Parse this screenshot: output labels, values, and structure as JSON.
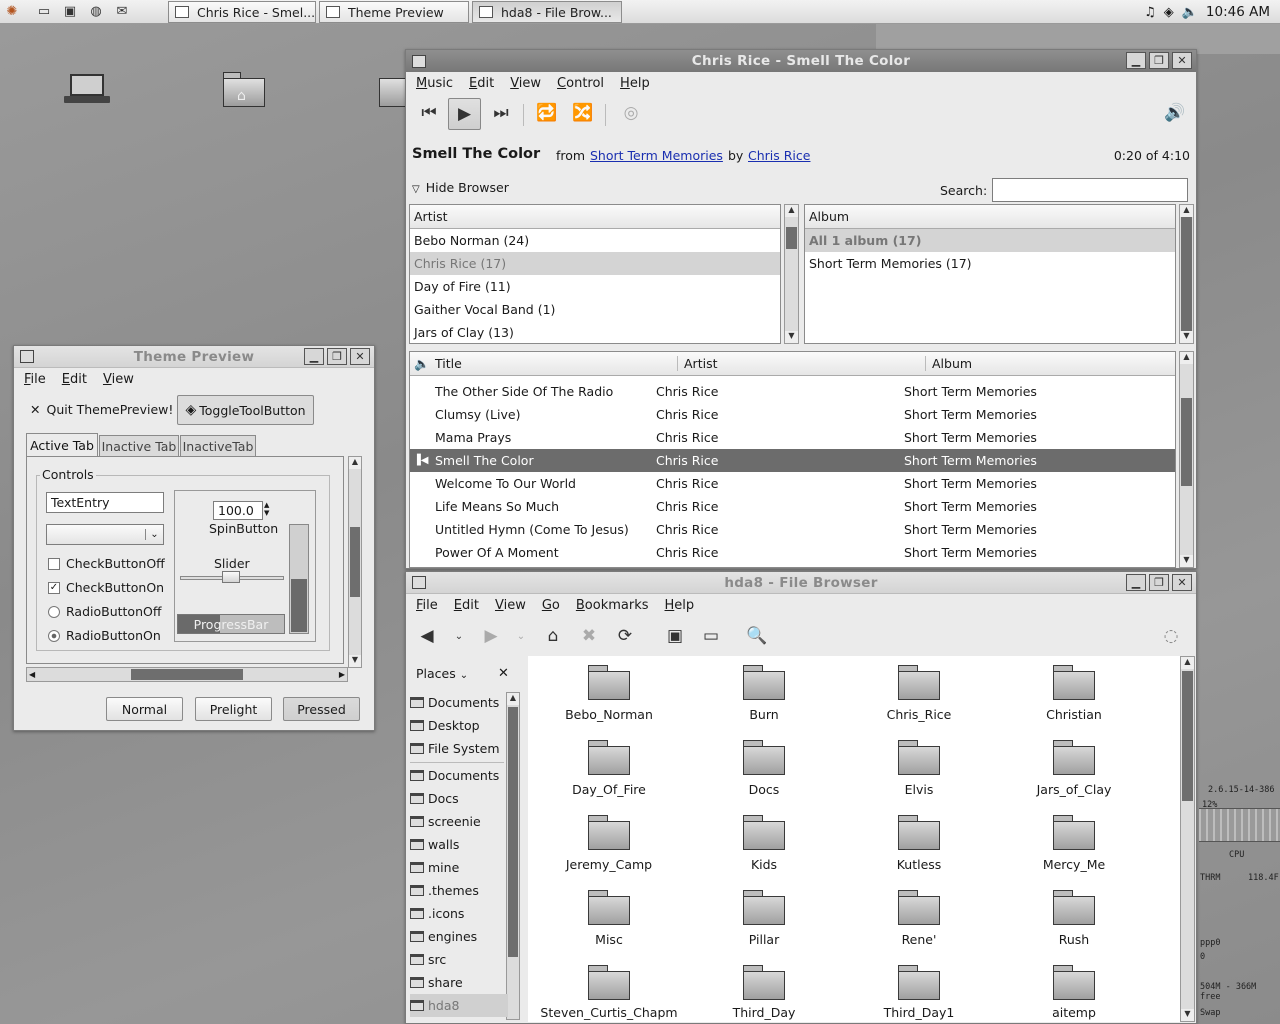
{
  "panel": {
    "tasks": [
      "Chris Rice - Smel...",
      "Theme Preview",
      "hda8 - File Brow..."
    ],
    "clock": "10:46 AM"
  },
  "music": {
    "title": "Chris Rice - Smell The Color",
    "menu": [
      "Music",
      "Edit",
      "View",
      "Control",
      "Help"
    ],
    "song": "Smell The Color",
    "from": "from",
    "album_link": "Short Term Memories",
    "by": "by",
    "artist_link": "Chris Rice",
    "time": "0:20 of 4:10",
    "hide_browser": "Hide Browser",
    "search_label": "Search:",
    "search_value": "",
    "artist_header": "Artist",
    "artists": [
      "Bebo Norman (24)",
      "Chris Rice (17)",
      "Day of Fire (11)",
      "Gaither Vocal Band (1)",
      "Jars of Clay (13)"
    ],
    "album_header": "Album",
    "albums": [
      "All 1 album (17)",
      "Short Term Memories (17)"
    ],
    "track_headers": [
      "Title",
      "Artist",
      "Album"
    ],
    "tracks": [
      {
        "title": "The Other Side Of The Radio",
        "artist": "Chris Rice",
        "album": "Short Term Memories"
      },
      {
        "title": "Clumsy (Live)",
        "artist": "Chris Rice",
        "album": "Short Term Memories"
      },
      {
        "title": "Mama Prays",
        "artist": "Chris Rice",
        "album": "Short Term Memories"
      },
      {
        "title": "Smell The Color",
        "artist": "Chris Rice",
        "album": "Short Term Memories"
      },
      {
        "title": "Welcome To Our World",
        "artist": "Chris Rice",
        "album": "Short Term Memories"
      },
      {
        "title": "Life Means So Much",
        "artist": "Chris Rice",
        "album": "Short Term Memories"
      },
      {
        "title": "Untitled Hymn (Come To Jesus)",
        "artist": "Chris Rice",
        "album": "Short Term Memories"
      },
      {
        "title": "Power Of A Moment",
        "artist": "Chris Rice",
        "album": "Short Term Memories"
      }
    ]
  },
  "files": {
    "title": "hda8 - File Browser",
    "menu": [
      "File",
      "Edit",
      "View",
      "Go",
      "Bookmarks",
      "Help"
    ],
    "places_label": "Places",
    "places": [
      "Documents",
      "Desktop",
      "File System",
      "Documents",
      "Docs",
      "screenie",
      "walls",
      "mine",
      ".themes",
      ".icons",
      "engines",
      "src",
      "share",
      "hda8"
    ],
    "folders": [
      "Bebo_Norman",
      "Burn",
      "Chris_Rice",
      "Christian",
      "Day_Of_Fire",
      "Docs",
      "Elvis",
      "Jars_of_Clay",
      "Jeremy_Camp",
      "Kids",
      "Kutless",
      "Mercy_Me",
      "Misc",
      "Pillar",
      "Rene'",
      "Rush",
      "Steven_Curtis_Chapm",
      "Third_Day",
      "Third_Day1",
      "aitemp"
    ]
  },
  "theme": {
    "title": "Theme Preview",
    "menu": [
      "File",
      "Edit",
      "View"
    ],
    "quit": "Quit ThemePreview!",
    "toggle": "ToggleToolButton",
    "tabs": [
      "Active Tab",
      "Inactive Tab",
      "InactiveTab"
    ],
    "controls": "Controls",
    "text_entry": "TextEntry",
    "spin_value": "100.0",
    "spin_label": "SpinButton",
    "slider_label": "Slider",
    "progress_label": "ProgressBar",
    "progress": 0.4,
    "checks": [
      "CheckButtonOff",
      "CheckButtonOn"
    ],
    "radios": [
      "RadioButtonOff",
      "RadioButtonOn"
    ],
    "buttons": [
      "Normal",
      "Prelight",
      "Pressed"
    ]
  },
  "sysmon": {
    "kernel": "2.6.15-14-386",
    "cpu_pct": "12%",
    "cpu": "CPU",
    "thrm": "THRM",
    "temp": "118.4F",
    "net": "ppp0",
    "net_val": "0",
    "mem": "504M - 366M free",
    "swap": "Swap"
  }
}
